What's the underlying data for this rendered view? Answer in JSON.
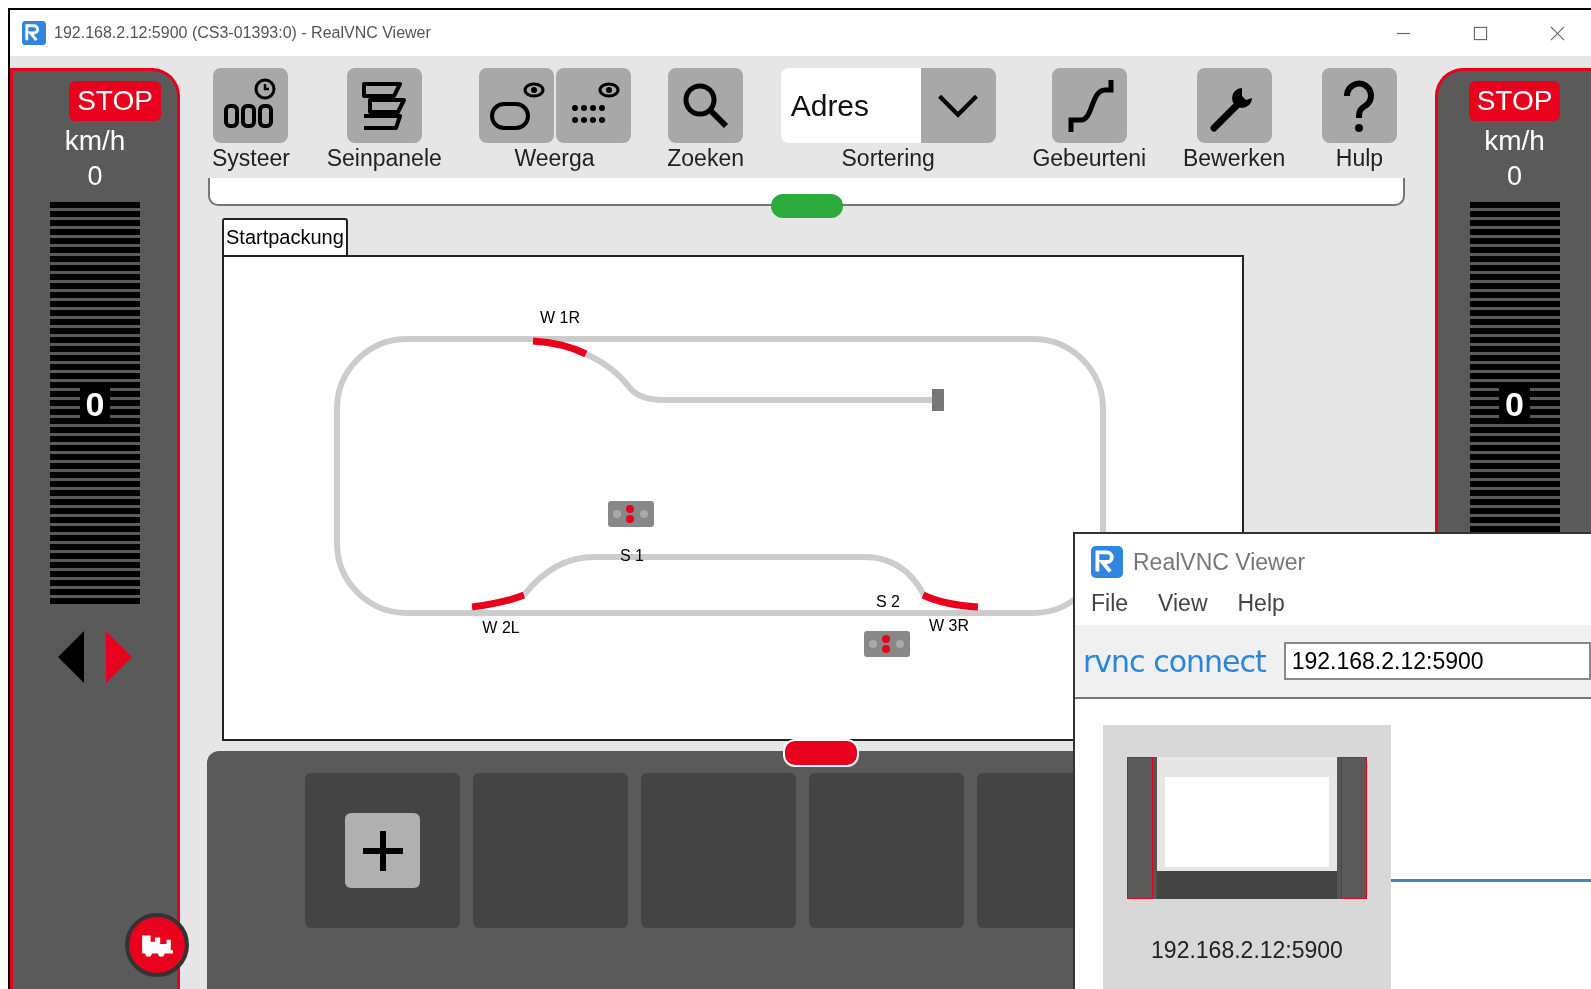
{
  "window": {
    "title": "192.168.2.12:5900 (CS3-01393:0) - RealVNC Viewer"
  },
  "throttles": [
    {
      "stop": "STOP",
      "unit": "km/h",
      "speed": "0",
      "display": "0",
      "level": 0,
      "forward": true
    },
    {
      "stop": "STOP",
      "unit": "km/h",
      "speed": "0",
      "display": "0",
      "level": 0
    }
  ],
  "toolbar": [
    {
      "kind": "system",
      "label": "Systeer"
    },
    {
      "kind": "panels",
      "label": "Seinpanele"
    },
    {
      "kind": "view",
      "label": "Weerga"
    },
    {
      "kind": "search",
      "label": "Zoeken"
    },
    {
      "kind": "dropdown",
      "label": "Sortering",
      "value": "Adres"
    },
    {
      "kind": "events",
      "label": "Gebeurteni"
    },
    {
      "kind": "edit",
      "label": "Bewerken"
    },
    {
      "kind": "help",
      "label": "Hulp"
    }
  ],
  "layout_tab": {
    "label": "Startpackung"
  },
  "track": {
    "turnouts": [
      {
        "label": "W 1R"
      },
      {
        "label": "W 2L"
      },
      {
        "label": "W 3R"
      }
    ],
    "signals": [
      {
        "label": "S 1"
      },
      {
        "label": "S 2"
      }
    ]
  },
  "vnc_window": {
    "title": "RealVNC Viewer",
    "menu": [
      "File",
      "View",
      "Help"
    ],
    "logo": "rvnc connect",
    "address": "192.168.2.12:5900",
    "thumbnail_label": "192.168.2.12:5900"
  }
}
